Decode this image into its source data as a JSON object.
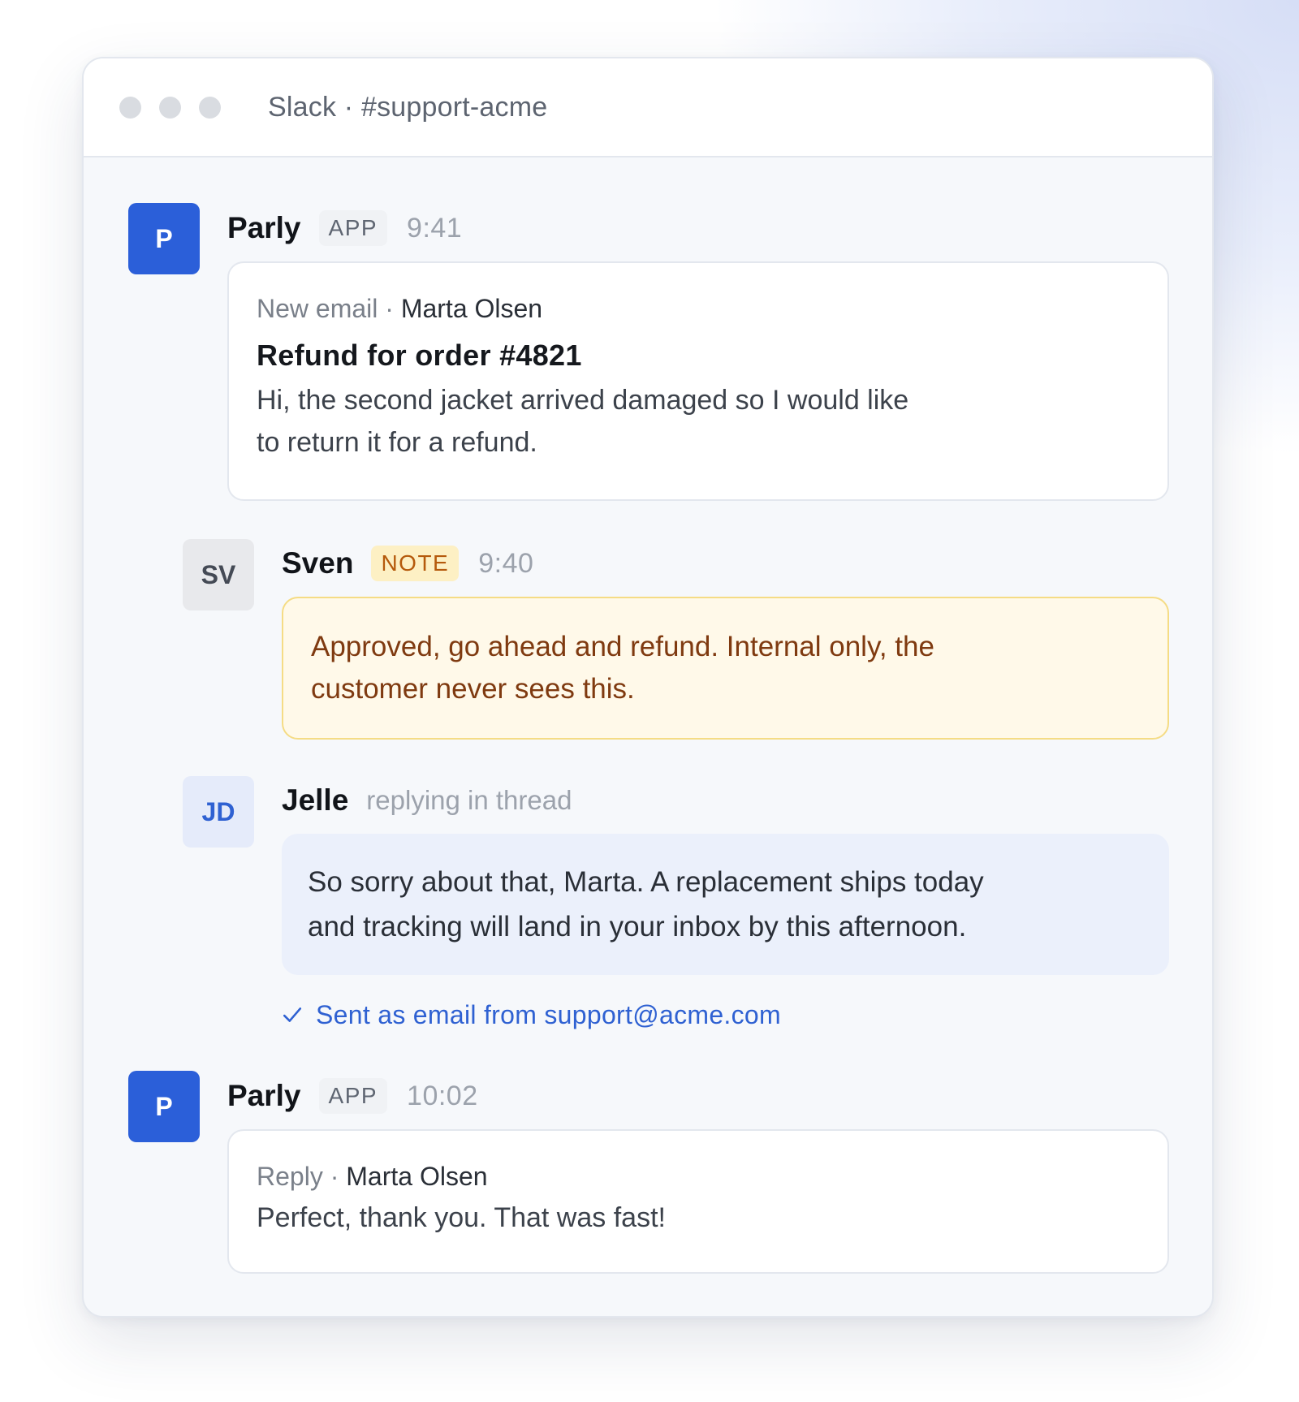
{
  "window": {
    "title": "Slack · #support-acme"
  },
  "messages": [
    {
      "avatar": "P",
      "name": "Parly",
      "tag": "APP",
      "time": "9:41",
      "card": {
        "label": "New email",
        "separator": " · ",
        "sender": "Marta Olsen",
        "subject": "Refund for order #4821",
        "line1": "Hi, the second jacket arrived damaged so I would like",
        "line2": "to return it for a refund."
      }
    },
    {
      "avatar": "SV",
      "name": "Sven",
      "tag": "NOTE",
      "time": "9:40",
      "card": {
        "line1": "Approved, go ahead and refund. Internal only, the",
        "line2": "customer never sees this."
      }
    },
    {
      "avatar": "JD",
      "name": "Jelle",
      "subtitle": "replying in thread",
      "card": {
        "line1": "So sorry about that, Marta. A replacement ships today",
        "line2": "and tracking will land in your inbox by this afternoon."
      },
      "status": "Sent as email from support@acme.com"
    },
    {
      "avatar": "P",
      "name": "Parly",
      "tag": "APP",
      "time": "10:02",
      "card": {
        "label": "Reply",
        "separator": " · ",
        "sender": "Marta Olsen",
        "line1": "Perfect, thank you. That was fast!"
      }
    }
  ],
  "colors": {
    "app_avatar": "#2b5fd9",
    "note_bg": "#fff9e9",
    "note_border": "#f5dc85",
    "link": "#2f61d2"
  },
  "icons": {
    "status": "check-icon"
  }
}
